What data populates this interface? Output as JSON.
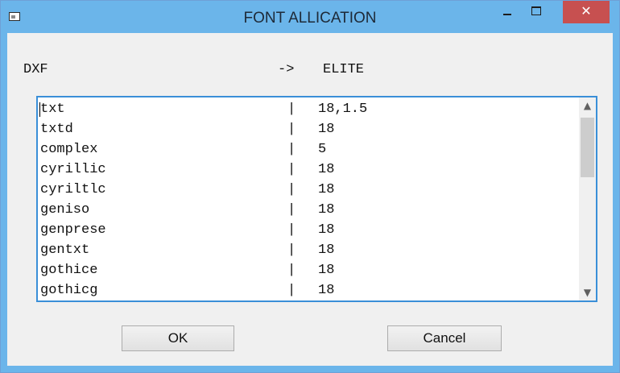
{
  "window": {
    "title": "FONT ALLICATION",
    "controls": {
      "minimize": "minimize",
      "maximize": "maximize",
      "close": "close"
    }
  },
  "header": {
    "left": "DXF",
    "arrow": "->",
    "right": "ELITE"
  },
  "list": {
    "separator": "|",
    "rows": [
      {
        "dxf": "txt",
        "elite": "18,1.5"
      },
      {
        "dxf": "txtd",
        "elite": "18"
      },
      {
        "dxf": "complex",
        "elite": "5"
      },
      {
        "dxf": "cyrillic",
        "elite": "18"
      },
      {
        "dxf": "cyriltlc",
        "elite": "18"
      },
      {
        "dxf": "geniso",
        "elite": "18"
      },
      {
        "dxf": "genprese",
        "elite": "18"
      },
      {
        "dxf": "gentxt",
        "elite": "18"
      },
      {
        "dxf": "gothice",
        "elite": "18"
      },
      {
        "dxf": "gothicg",
        "elite": "18"
      }
    ]
  },
  "buttons": {
    "ok": "OK",
    "cancel": "Cancel"
  },
  "colors": {
    "titlebar": "#6bb5ea",
    "close_button": "#c75050",
    "list_border": "#3a8fd8",
    "dialog_background": "#f0f0f0"
  }
}
